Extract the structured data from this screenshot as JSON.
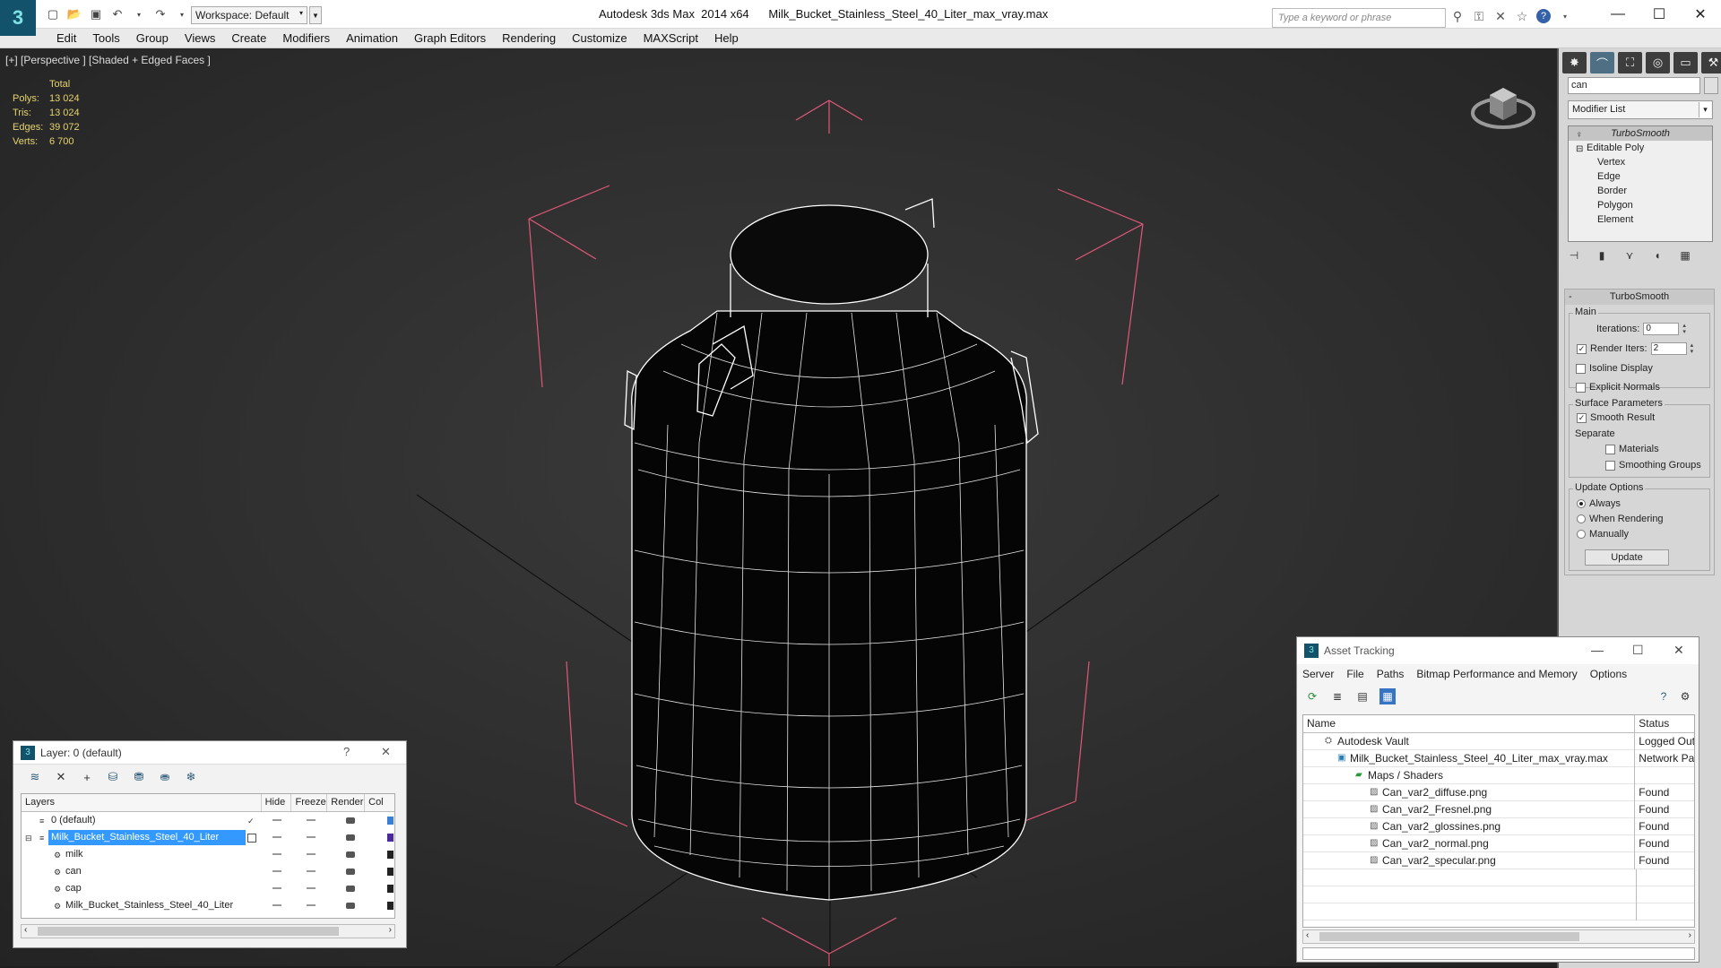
{
  "app": {
    "title": "Autodesk 3ds Max  2014 x64      Milk_Bucket_Stainless_Steel_40_Liter_max_vray.max",
    "workspace": "Workspace: Default",
    "search_placeholder": "Type a keyword or phrase"
  },
  "menu": [
    "Edit",
    "Tools",
    "Group",
    "Views",
    "Create",
    "Modifiers",
    "Animation",
    "Graph Editors",
    "Rendering",
    "Customize",
    "MAXScript",
    "Help"
  ],
  "viewport": {
    "label": "[+] [Perspective ] [Shaded + Edged Faces ]",
    "stats_header": "Total",
    "stats": [
      {
        "k": "Polys:",
        "v": "13 024"
      },
      {
        "k": "Tris:",
        "v": "13 024"
      },
      {
        "k": "Edges:",
        "v": "39 072"
      },
      {
        "k": "Verts:",
        "v": "6 700"
      }
    ]
  },
  "command_panel": {
    "object_name": "can",
    "modifier_list": "Modifier List",
    "stack": {
      "modifier": "TurboSmooth",
      "base": "Editable Poly",
      "subs": [
        "Vertex",
        "Edge",
        "Border",
        "Polygon",
        "Element"
      ]
    },
    "turbosmooth": {
      "title": "TurboSmooth",
      "main_group": "Main",
      "iterations_label": "Iterations:",
      "iterations": "0",
      "render_iters_label": "Render Iters:",
      "render_iters": "2",
      "isoline": "Isoline Display",
      "explicit_normals": "Explicit Normals",
      "surface_group": "Surface Parameters",
      "smooth_result": "Smooth Result",
      "separate": "Separate",
      "materials": "Materials",
      "smoothing_groups": "Smoothing Groups",
      "update_group": "Update Options",
      "always": "Always",
      "when_rendering": "When Rendering",
      "manually": "Manually",
      "update_button": "Update"
    }
  },
  "layer_window": {
    "title": "Layer: 0 (default)",
    "help": "?",
    "columns": [
      "Layers",
      "Hide",
      "Freeze",
      "Render",
      "Col"
    ],
    "rows": [
      {
        "name": "0 (default)",
        "indent": 0,
        "color": "#3a7fd5",
        "selected": false
      },
      {
        "name": "Milk_Bucket_Stainless_Steel_40_Liter",
        "indent": 0,
        "color": "#4a2a9a",
        "selected": true
      },
      {
        "name": "milk",
        "indent": 1,
        "color": "#222222",
        "selected": false
      },
      {
        "name": "can",
        "indent": 1,
        "color": "#222222",
        "selected": false
      },
      {
        "name": "cap",
        "indent": 1,
        "color": "#222222",
        "selected": false
      },
      {
        "name": "Milk_Bucket_Stainless_Steel_40_Liter",
        "indent": 1,
        "color": "#222222",
        "selected": false
      }
    ]
  },
  "asset_tracking": {
    "title": "Asset Tracking",
    "menu": [
      "Server",
      "File",
      "Paths",
      "Bitmap Performance and Memory",
      "Options"
    ],
    "columns": [
      "Name",
      "Status"
    ],
    "rows": [
      {
        "name": "Autodesk Vault",
        "status": "Logged Out",
        "indent": 0
      },
      {
        "name": "Milk_Bucket_Stainless_Steel_40_Liter_max_vray.max",
        "status": "Network Pat",
        "indent": 1
      },
      {
        "name": "Maps / Shaders",
        "status": "",
        "indent": 2
      },
      {
        "name": "Can_var2_diffuse.png",
        "status": "Found",
        "indent": 3
      },
      {
        "name": "Can_var2_Fresnel.png",
        "status": "Found",
        "indent": 3
      },
      {
        "name": "Can_var2_glossines.png",
        "status": "Found",
        "indent": 3
      },
      {
        "name": "Can_var2_normal.png",
        "status": "Found",
        "indent": 3
      },
      {
        "name": "Can_var2_specular.png",
        "status": "Found",
        "indent": 3
      }
    ]
  }
}
